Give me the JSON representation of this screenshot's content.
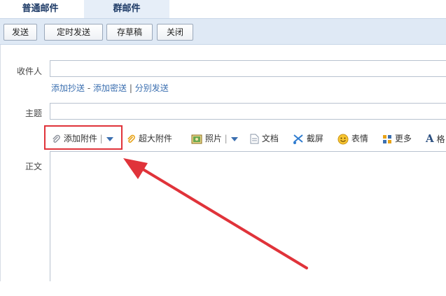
{
  "tabs": {
    "normal": "普通邮件",
    "group": "群邮件"
  },
  "toolbar": {
    "send": "发送",
    "scheduled_send": "定时发送",
    "save_draft": "存草稿",
    "close": "关闭"
  },
  "form": {
    "recipient_label": "收件人",
    "cc_link": "添加抄送",
    "dash": "-",
    "bcc_link": "添加密送",
    "bar": "|",
    "separate_link": "分别发送",
    "subject_label": "主题",
    "body_label": "正文"
  },
  "editor_toolbar": {
    "attach": "添加附件",
    "big_attach": "超大附件",
    "photo": "照片",
    "doc": "文档",
    "screenshot": "截屏",
    "emoji": "表情",
    "more": "更多",
    "format_partial": "格"
  },
  "colors": {
    "accent": "#3b6fb0",
    "highlight": "#e0333a",
    "toolbar_bg": "#dfe9f5"
  }
}
